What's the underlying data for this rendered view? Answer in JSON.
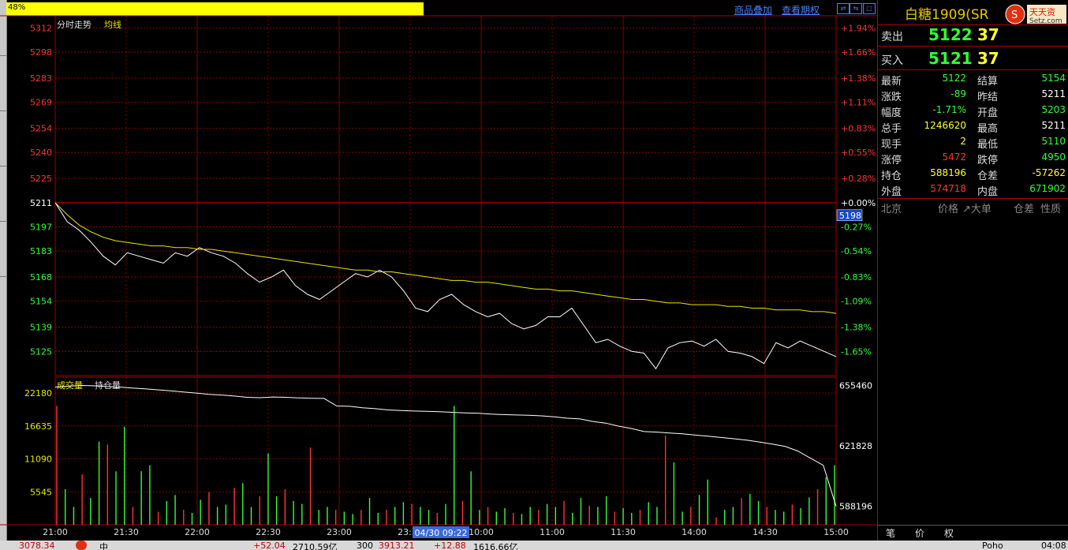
{
  "progress": {
    "label": "48%"
  },
  "toolbar": {
    "overlay_label": "商品叠加",
    "period_label": "查看期权"
  },
  "chart_header": {
    "title": "分时走势",
    "avg_label": "均线"
  },
  "vol_header": {
    "vol_label": "成交量",
    "oi_label": "持仓量"
  },
  "price_axis": {
    "left": [
      "5312",
      "5298",
      "5283",
      "5269",
      "5254",
      "5240",
      "5225",
      "5211",
      "5197",
      "5183",
      "5168",
      "5154",
      "5139",
      "5125"
    ],
    "right": [
      "+1.94%",
      "+1.66%",
      "+1.38%",
      "+1.11%",
      "+0.83%",
      "+0.55%",
      "+0.28%",
      "+0.00%",
      "-0.27%",
      "-0.54%",
      "-0.83%",
      "-1.09%",
      "-1.38%",
      "-1.65%"
    ],
    "current_tag": "5198"
  },
  "volume_axis": {
    "left": [
      "22180",
      "16635",
      "11090",
      "5545"
    ],
    "right": [
      "655460",
      "621828",
      "588196"
    ]
  },
  "time_axis": [
    "21:00",
    "21:30",
    "22:00",
    "22:30",
    "23:00",
    "23:30",
    "10:00",
    "11:00",
    "11:30",
    "14:00",
    "14:30",
    "15:00"
  ],
  "cursor_time": "04/30 09:22",
  "chart_data": {
    "type": "line",
    "xlabel": "",
    "ylabel": "",
    "ylim": [
      5111,
      5319
    ],
    "prev_settle": 5211,
    "series": [
      {
        "name": "分时走势",
        "values": [
          5211,
          5200,
          5195,
          5188,
          5180,
          5175,
          5182,
          5180,
          5178,
          5176,
          5182,
          5180,
          5185,
          5182,
          5180,
          5176,
          5170,
          5165,
          5168,
          5172,
          5163,
          5158,
          5155,
          5160,
          5165,
          5170,
          5168,
          5172,
          5168,
          5160,
          5150,
          5148,
          5155,
          5158,
          5152,
          5148,
          5145,
          5147,
          5141,
          5138,
          5140,
          5145,
          5145,
          5150,
          5140,
          5130,
          5132,
          5128,
          5125,
          5124,
          5115,
          5127,
          5130,
          5131,
          5128,
          5132,
          5125,
          5124,
          5122,
          5118,
          5130,
          5127,
          5131,
          5128,
          5125,
          5122
        ]
      },
      {
        "name": "均线",
        "values": [
          5211,
          5204,
          5198,
          5194,
          5191,
          5189,
          5188,
          5187,
          5186,
          5186,
          5185,
          5185,
          5184,
          5184,
          5183,
          5182,
          5181,
          5180,
          5179,
          5178,
          5177,
          5176,
          5175,
          5174,
          5173,
          5172,
          5172,
          5171,
          5171,
          5170,
          5169,
          5168,
          5167,
          5166,
          5166,
          5165,
          5165,
          5164,
          5163,
          5162,
          5161,
          5161,
          5160,
          5160,
          5159,
          5158,
          5157,
          5156,
          5155,
          5155,
          5154,
          5153,
          5153,
          5152,
          5152,
          5152,
          5151,
          5151,
          5150,
          5150,
          5149,
          5149,
          5149,
          5148,
          5148,
          5147
        ]
      }
    ],
    "volume": {
      "ylim": [
        0,
        22180
      ],
      "values": [
        20000,
        6000,
        3000,
        8500,
        4500,
        14000,
        13500,
        9000,
        16500,
        3000,
        9000,
        10000,
        2200,
        4000,
        5000,
        2500,
        2000,
        4200,
        5500,
        3000,
        3400,
        6200,
        7000,
        3000,
        4800,
        12000,
        4800,
        6000,
        4000,
        3500,
        13000,
        2500,
        3000,
        2500,
        2200,
        1800,
        2500,
        4500,
        2000,
        2500,
        3000,
        3800,
        3500,
        3000,
        2500,
        2000,
        3500,
        20000,
        4000,
        9000,
        2500,
        3000,
        2200,
        2800,
        2000,
        1800,
        3000,
        2500,
        3500,
        3000,
        4000,
        2000,
        4500,
        3200,
        3000,
        4800,
        2200,
        2800,
        2000,
        2500,
        3800,
        3000,
        15000,
        10500,
        2200,
        3000,
        5000,
        7600,
        1200,
        2500,
        3000,
        4500,
        5200,
        4000,
        3000,
        2500,
        2200,
        3400,
        2800,
        4600,
        6000,
        8000,
        10000
      ]
    },
    "open_interest": {
      "ylim": [
        578000,
        660000
      ],
      "values": [
        654500,
        655000,
        655400,
        655200,
        654800,
        654500,
        654000,
        653500,
        653000,
        652400,
        651800,
        651200,
        650500,
        650100,
        649500,
        648800,
        648600,
        649000,
        648800,
        648500,
        648300,
        648200,
        644000,
        643800,
        643000,
        642500,
        641800,
        641500,
        641200,
        641000,
        640800,
        640500,
        640200,
        640000,
        639500,
        639200,
        639000,
        638800,
        638500,
        638000,
        637200,
        636800,
        635400,
        634500,
        632800,
        631500,
        629800,
        629500,
        629000,
        628500,
        627800,
        627200,
        626500,
        625800,
        625000,
        624000,
        622800,
        621600,
        619000,
        615000,
        611000,
        588196
      ]
    }
  },
  "quote": {
    "title": "白糖1909(SR",
    "ask_label": "卖出",
    "ask_price": "5122",
    "ask_vol": "37",
    "bid_label": "买入",
    "bid_price": "5121",
    "bid_vol": "37",
    "rows": [
      {
        "l1": "最新",
        "v1": "5122",
        "c1": "green",
        "l2": "结算",
        "v2": "5154",
        "c2": "green"
      },
      {
        "l1": "涨跌",
        "v1": "-89",
        "c1": "green",
        "l2": "昨结",
        "v2": "5211",
        "c2": "white"
      },
      {
        "l1": "幅度",
        "v1": "-1.71%",
        "c1": "green",
        "l2": "开盘",
        "v2": "5203",
        "c2": "green"
      },
      {
        "l1": "总手",
        "v1": "1246620",
        "c1": "yellow",
        "l2": "最高",
        "v2": "5211",
        "c2": "white"
      },
      {
        "l1": "现手",
        "v1": "2",
        "c1": "yellow",
        "l2": "最低",
        "v2": "5110",
        "c2": "green"
      },
      {
        "l1": "涨停",
        "v1": "5472",
        "c1": "red",
        "l2": "跌停",
        "v2": "4950",
        "c2": "green"
      },
      {
        "l1": "持仓",
        "v1": "588196",
        "c1": "yellow",
        "l2": "仓差",
        "v2": "-57262",
        "c2": "yellow"
      },
      {
        "l1": "外盘",
        "v1": "574718",
        "c1": "red",
        "l2": "内盘",
        "v2": "671902",
        "c2": "green"
      }
    ],
    "ticks_header": {
      "place": "北京",
      "price": "价格",
      "big": "↗大单",
      "oi": "仓差",
      "nature": "性质"
    },
    "tabs": [
      "笔",
      "价",
      "权"
    ]
  },
  "taskbar": {
    "items": [
      "3078.34",
      "中",
      "+52.04",
      "2710.59亿",
      "300",
      "3913.21",
      "+12.88",
      "1616.66亿",
      "Poho",
      "04:08"
    ]
  },
  "colors": {
    "grid": "#a00000",
    "price_line": "#ffffff",
    "avg_line": "#e6e600",
    "up": "#ff3333",
    "down": "#33ff33"
  }
}
